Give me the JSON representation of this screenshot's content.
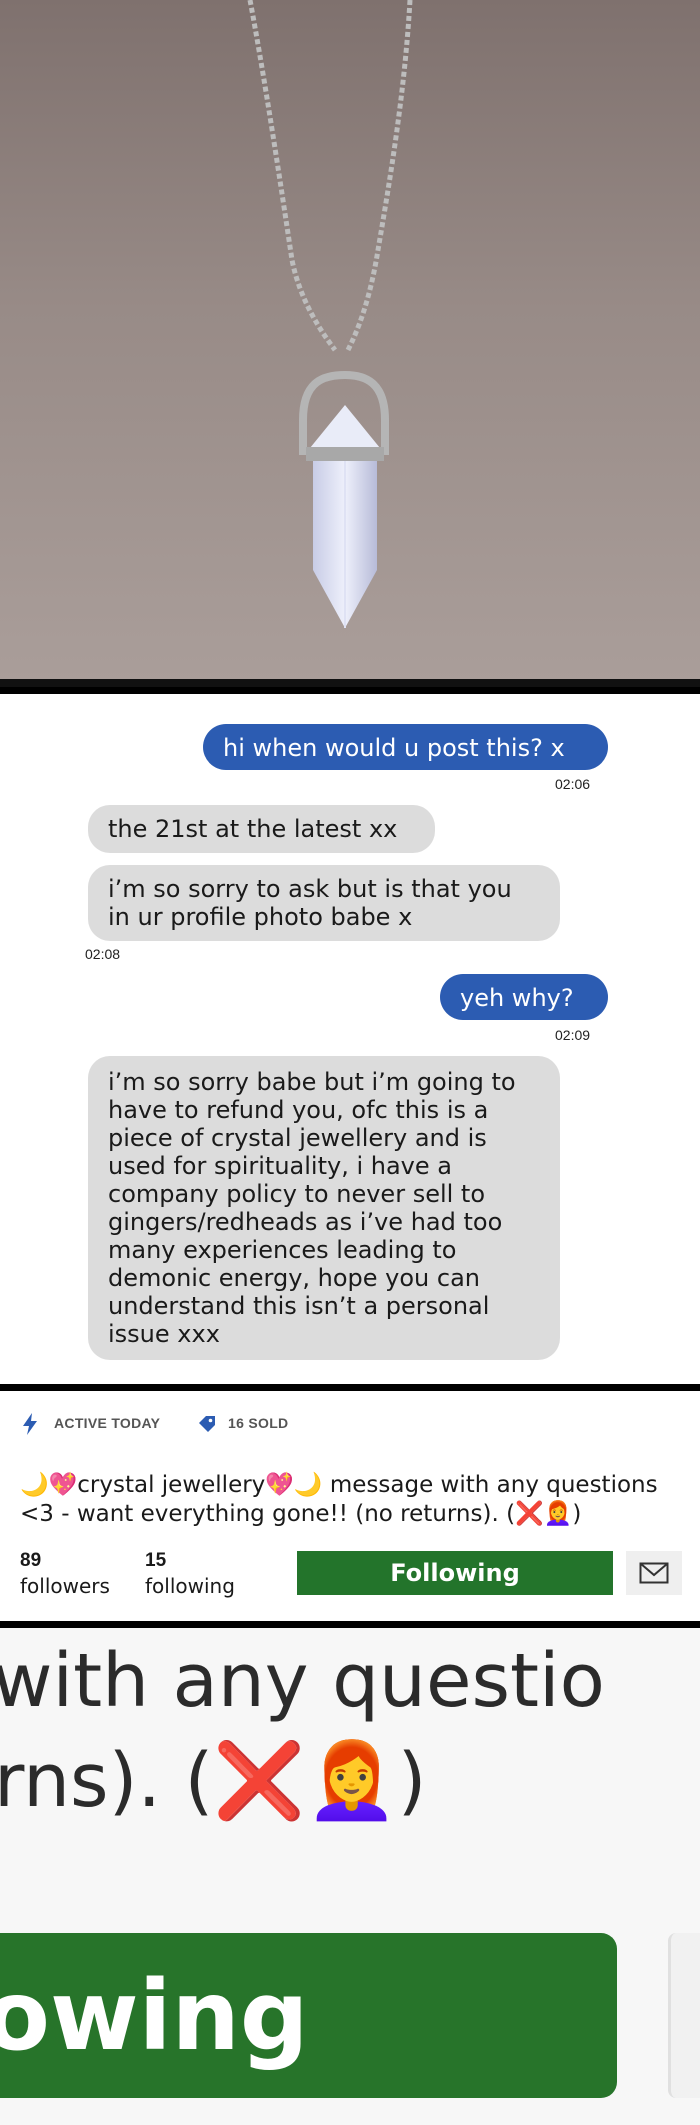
{
  "chat": {
    "messages": [
      {
        "from": "buyer",
        "text": "hi when would u post this? x"
      },
      {
        "from": "buyer",
        "time": "02:06"
      },
      {
        "from": "seller",
        "text": "the 21st at the latest xx"
      },
      {
        "from": "seller",
        "lines": [
          "i’m so sorry to ask but is that you",
          "in ur profile photo babe x"
        ]
      },
      {
        "from": "seller",
        "time": "02:08"
      },
      {
        "from": "buyer",
        "text": "yeh why?"
      },
      {
        "from": "buyer",
        "time": "02:09"
      },
      {
        "from": "seller",
        "lines": [
          "i’m so sorry babe but i’m going to",
          "have to refund you, ofc this is a",
          "piece of crystal jewellery and is",
          "used for spirituality, i have a",
          "company policy to never sell to",
          "gingers/redheads as i’ve had too",
          "many experiences leading to",
          "demonic energy, hope you can",
          "understand this isn’t a personal",
          "issue xxx"
        ]
      }
    ]
  },
  "profile": {
    "active_label": "ACTIVE TODAY",
    "sold_label": "16 SOLD",
    "bio_line1": "🌙💖crystal jewellery💖🌙 message with any questions",
    "bio_line2": "<3 - want everything gone!! (no returns). (❌👩‍🦰)",
    "followers_count": "89",
    "followers_label": "followers",
    "following_count": "15",
    "following_label": "following",
    "follow_button": "Following",
    "icons": {
      "active": "lightning-icon",
      "sold": "tag-icon",
      "message": "envelope-icon"
    },
    "colors": {
      "button": "#23742b",
      "accent": "#2c5cb2"
    }
  },
  "zoom": {
    "line1": "with any questio",
    "line2": "rns). (",
    "line2_emoji": "❌👩‍🦰",
    "line2_end": ")",
    "button_text": "owing"
  }
}
